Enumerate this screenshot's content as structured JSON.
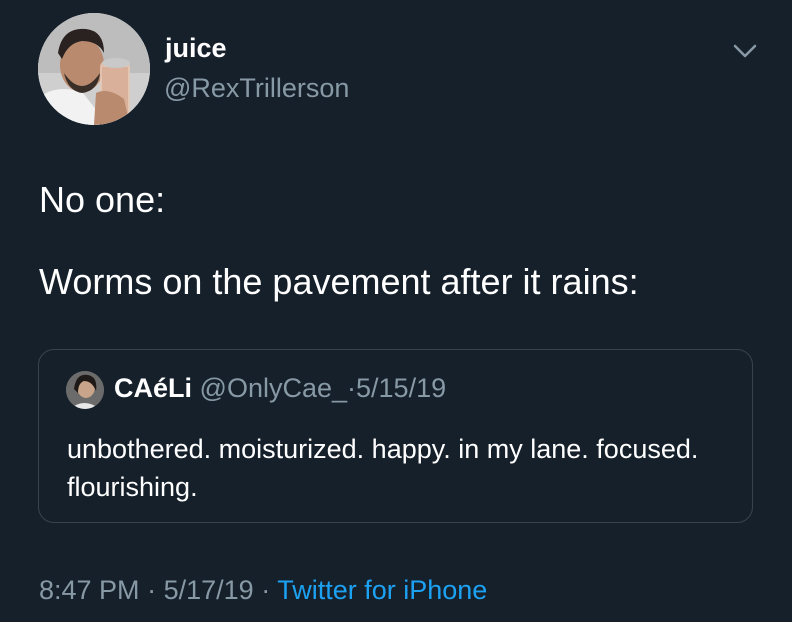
{
  "author": {
    "display_name": "juice",
    "handle": "@RexTrillerson"
  },
  "tweet": {
    "lines": [
      "No one:",
      "Worms on the pavement after it rains:"
    ]
  },
  "quoted_tweet": {
    "display_name": "CAéLi",
    "handle": "@OnlyCae_",
    "separator": "·",
    "date": "5/15/19",
    "text": "unbothered. moisturized. happy. in my lane. focused. flourishing."
  },
  "footer": {
    "time": "8:47 PM",
    "separator1": "·",
    "date": "5/17/19",
    "separator2": "·",
    "source": "Twitter for iPhone"
  },
  "colors": {
    "background": "#15202b",
    "primary_text": "#ffffff",
    "secondary_text": "#8899a6",
    "link": "#1da1f2",
    "border": "#38444d"
  },
  "icons": {
    "menu": "chevron-down-icon"
  }
}
